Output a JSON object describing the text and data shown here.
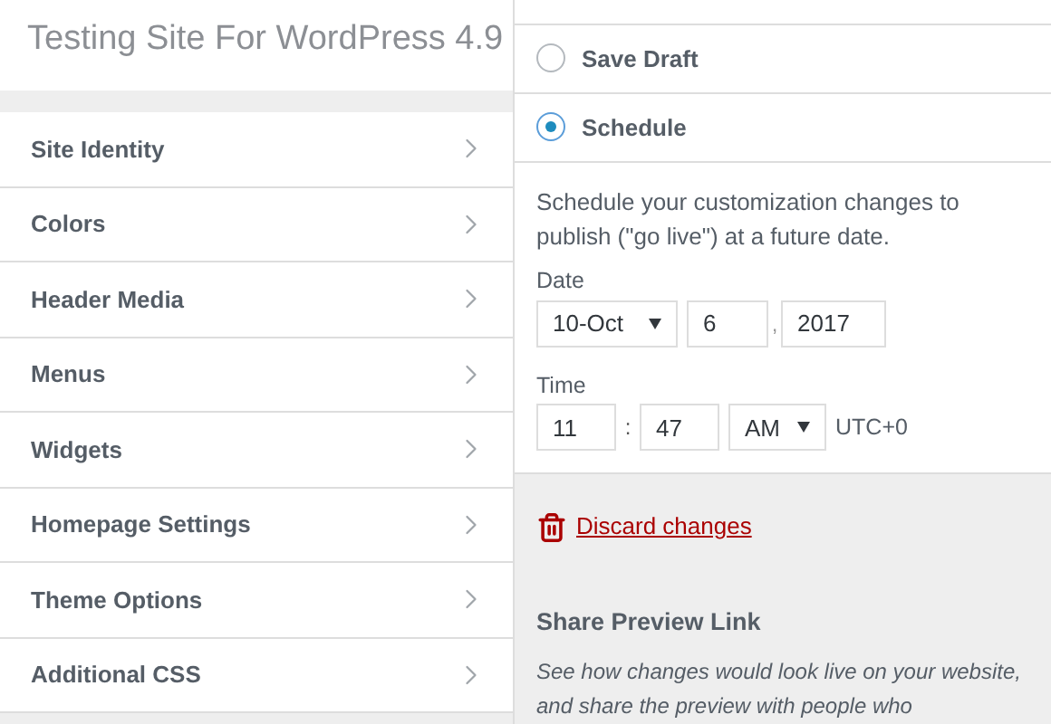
{
  "header": {
    "title": "Testing Site For WordPress 4.9"
  },
  "menu": [
    {
      "label": "Site Identity"
    },
    {
      "label": "Colors"
    },
    {
      "label": "Header Media"
    },
    {
      "label": "Menus"
    },
    {
      "label": "Widgets"
    },
    {
      "label": "Homepage Settings"
    },
    {
      "label": "Theme Options"
    },
    {
      "label": "Additional CSS"
    }
  ],
  "publish_options": [
    {
      "label": "Save Draft",
      "selected": false
    },
    {
      "label": "Schedule",
      "selected": true
    }
  ],
  "schedule": {
    "description": "Schedule your customization changes to publish (\"go live\") at a future date.",
    "date_label": "Date",
    "month": "10-Oct",
    "day": "6",
    "date_separator": ",",
    "year": "2017",
    "time_label": "Time",
    "hour": "11",
    "time_separator": ":",
    "minute": "47",
    "meridiem": "AM",
    "timezone": "UTC+0"
  },
  "discard": {
    "label": "Discard changes"
  },
  "share": {
    "title": "Share Preview Link",
    "description": "See how changes would look live on your website, and share the preview with people who"
  }
}
